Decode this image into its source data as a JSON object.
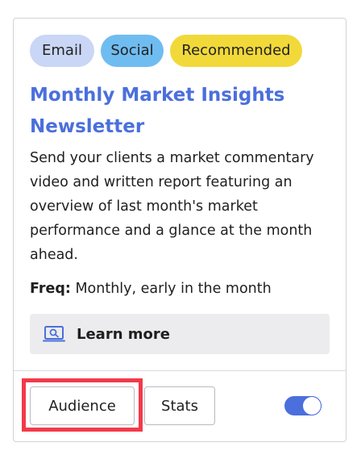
{
  "tags": [
    "Email",
    "Social",
    "Recommended"
  ],
  "title": "Monthly Market Insights Newsletter",
  "description": "Send your clients a market commentary video and written report featuring an overview of last month's market performance and a glance at the month ahead.",
  "freq": {
    "label": "Freq:",
    "value": "Monthly, early in the month"
  },
  "learn_more": {
    "label": "Learn more",
    "icon": "laptop-search-icon"
  },
  "buttons": {
    "audience": "Audience",
    "stats": "Stats"
  },
  "toggle": {
    "state": "on"
  },
  "colors": {
    "accent": "#4b6fdc",
    "tag_email": "#c9d6f5",
    "tag_social": "#6fbcf1",
    "tag_recommended": "#f1d93a",
    "highlight": "#f23a4a"
  }
}
